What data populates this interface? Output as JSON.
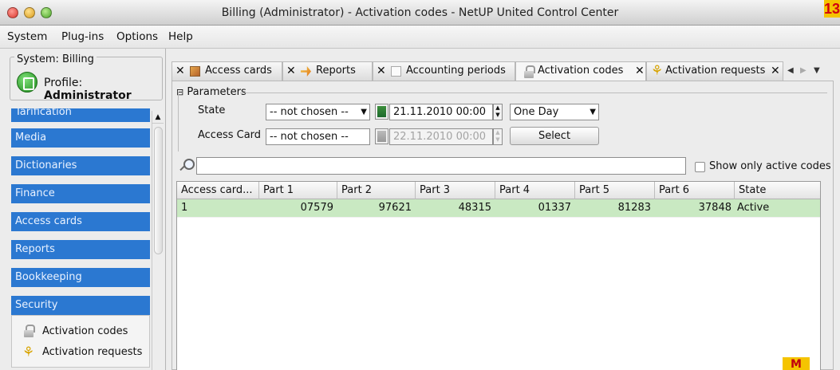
{
  "window": {
    "title": "Billing (Administrator) - Activation codes - NetUP United Control Center",
    "corner_badge": "13"
  },
  "menubar": [
    "System",
    "Plug-ins",
    "Options",
    "Help"
  ],
  "left": {
    "system_label": "System: Billing",
    "profile_prefix": "Profile:",
    "profile_name": "Administrator",
    "nav": [
      {
        "label": "Tarification"
      },
      {
        "label": "Media"
      },
      {
        "label": "Dictionaries"
      },
      {
        "label": "Finance"
      },
      {
        "label": "Access cards"
      },
      {
        "label": "Reports"
      },
      {
        "label": "Bookkeeping"
      },
      {
        "label": "Security"
      }
    ],
    "security_items": [
      {
        "label": "Activation codes",
        "icon": "lock-icon"
      },
      {
        "label": "Activation requests",
        "icon": "keys-icon"
      }
    ]
  },
  "tabs": [
    {
      "label": "Access cards",
      "icon": "access-cards-icon"
    },
    {
      "label": "Reports",
      "icon": "reports-icon"
    },
    {
      "label": "Accounting periods",
      "icon": "document-icon"
    },
    {
      "label": "Activation codes",
      "icon": "lock-icon",
      "active": true
    },
    {
      "label": "Activation requests",
      "icon": "keys-icon"
    }
  ],
  "params": {
    "legend": "Parameters",
    "state_label": "State",
    "state_value": "-- not chosen --",
    "date_from": "21.11.2010 00:00",
    "period_value": "One Day",
    "access_card_label": "Access Card",
    "access_card_value": "-- not chosen --",
    "date_to": "22.11.2010 00:00",
    "select_button": "Select"
  },
  "search": {
    "value": "",
    "show_active_label": "Show only active codes",
    "show_active_checked": false
  },
  "table": {
    "columns": [
      "Access card...",
      "Part 1",
      "Part 2",
      "Part 3",
      "Part 4",
      "Part 5",
      "Part 6",
      "State"
    ],
    "rows": [
      [
        "1",
        "07579",
        "97621",
        "48315",
        "01337",
        "81283",
        "37848",
        "Active"
      ]
    ]
  },
  "colors": {
    "nav_blue": "#2b78d1",
    "row_selected": "#c9e9c2"
  }
}
